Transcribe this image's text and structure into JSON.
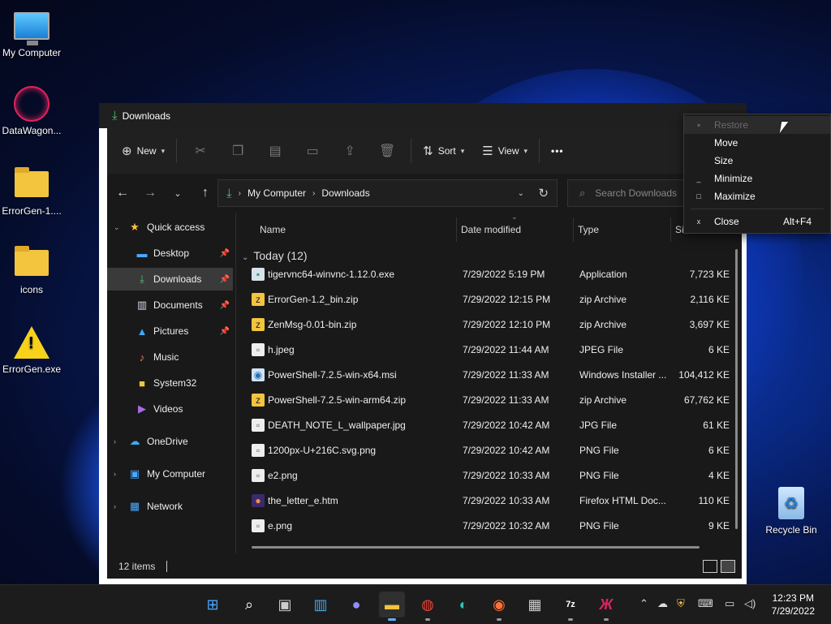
{
  "desktop": {
    "icons": [
      {
        "label": "My Computer",
        "icon": "monitor-icon"
      },
      {
        "label": "DataWagon...",
        "icon": "datawagon-icon"
      },
      {
        "label": "ErrorGen-1....",
        "icon": "folder-icon"
      },
      {
        "label": "icons",
        "icon": "folder-icon"
      },
      {
        "label": "ErrorGen.exe",
        "icon": "warning-icon"
      },
      {
        "label": "Recycle Bin",
        "icon": "recycle-bin-icon"
      }
    ]
  },
  "window": {
    "title": "Downloads",
    "toolbar": {
      "new_label": "New",
      "sort_label": "Sort",
      "view_label": "View",
      "more_label": "•••"
    },
    "address": {
      "crumbs": [
        "My Computer",
        "Downloads"
      ]
    },
    "search": {
      "placeholder": "Search Downloads"
    },
    "sidebar": {
      "items": [
        {
          "label": "Quick access",
          "icon": "star-icon"
        },
        {
          "label": "Desktop",
          "icon": "desktop-icon"
        },
        {
          "label": "Downloads",
          "icon": "download-icon"
        },
        {
          "label": "Documents",
          "icon": "documents-icon"
        },
        {
          "label": "Pictures",
          "icon": "pictures-icon"
        },
        {
          "label": "Music",
          "icon": "music-icon"
        },
        {
          "label": "System32",
          "icon": "folder-icon"
        },
        {
          "label": "Videos",
          "icon": "videos-icon"
        },
        {
          "label": "OneDrive",
          "icon": "cloud-icon"
        },
        {
          "label": "My Computer",
          "icon": "computer-icon"
        },
        {
          "label": "Network",
          "icon": "network-icon"
        }
      ]
    },
    "columns": [
      "Name",
      "Date modified",
      "Type",
      "Si"
    ],
    "group": "Today (12)",
    "files": [
      {
        "name": "tigervnc64-winvnc-1.12.0.exe",
        "date": "7/29/2022 5:19 PM",
        "type": "Application",
        "size": "7,723 KE"
      },
      {
        "name": "ErrorGen-1.2_bin.zip",
        "date": "7/29/2022 12:15 PM",
        "type": "zip Archive",
        "size": "2,116 KE"
      },
      {
        "name": "ZenMsg-0.01-bin.zip",
        "date": "7/29/2022 12:10 PM",
        "type": "zip Archive",
        "size": "3,697 KE"
      },
      {
        "name": "h.jpeg",
        "date": "7/29/2022 11:44 AM",
        "type": "JPEG File",
        "size": "6 KE"
      },
      {
        "name": "PowerShell-7.2.5-win-x64.msi",
        "date": "7/29/2022 11:33 AM",
        "type": "Windows Installer ...",
        "size": "104,412 KE"
      },
      {
        "name": "PowerShell-7.2.5-win-arm64.zip",
        "date": "7/29/2022 11:33 AM",
        "type": "zip Archive",
        "size": "67,762 KE"
      },
      {
        "name": "DEATH_NOTE_L_wallpaper.jpg",
        "date": "7/29/2022 10:42 AM",
        "type": "JPG File",
        "size": "61 KE"
      },
      {
        "name": "1200px-U+216C.svg.png",
        "date": "7/29/2022 10:42 AM",
        "type": "PNG File",
        "size": "6 KE"
      },
      {
        "name": "e2.png",
        "date": "7/29/2022 10:33 AM",
        "type": "PNG File",
        "size": "4 KE"
      },
      {
        "name": "the_letter_e.htm",
        "date": "7/29/2022 10:33 AM",
        "type": "Firefox HTML Doc...",
        "size": "110 KE"
      },
      {
        "name": "e.png",
        "date": "7/29/2022 10:32 AM",
        "type": "PNG File",
        "size": "9 KE"
      }
    ],
    "status": {
      "count": "12 items"
    }
  },
  "context_menu": {
    "items": [
      {
        "label": "Restore",
        "glyph": "▫",
        "disabled": true
      },
      {
        "label": "Move",
        "glyph": ""
      },
      {
        "label": "Size",
        "glyph": ""
      },
      {
        "label": "Minimize",
        "glyph": "_"
      },
      {
        "label": "Maximize",
        "glyph": "□"
      },
      {
        "label": "Close",
        "glyph": "x",
        "accel": "Alt+F4"
      }
    ]
  },
  "taskbar": {
    "clock_time": "12:23 PM",
    "clock_date": "7/29/2022",
    "apps": [
      "start",
      "search",
      "task-view",
      "widgets",
      "chat",
      "file-explorer",
      "chrome",
      "edge",
      "firefox",
      "store",
      "7zip",
      "notepad"
    ]
  }
}
